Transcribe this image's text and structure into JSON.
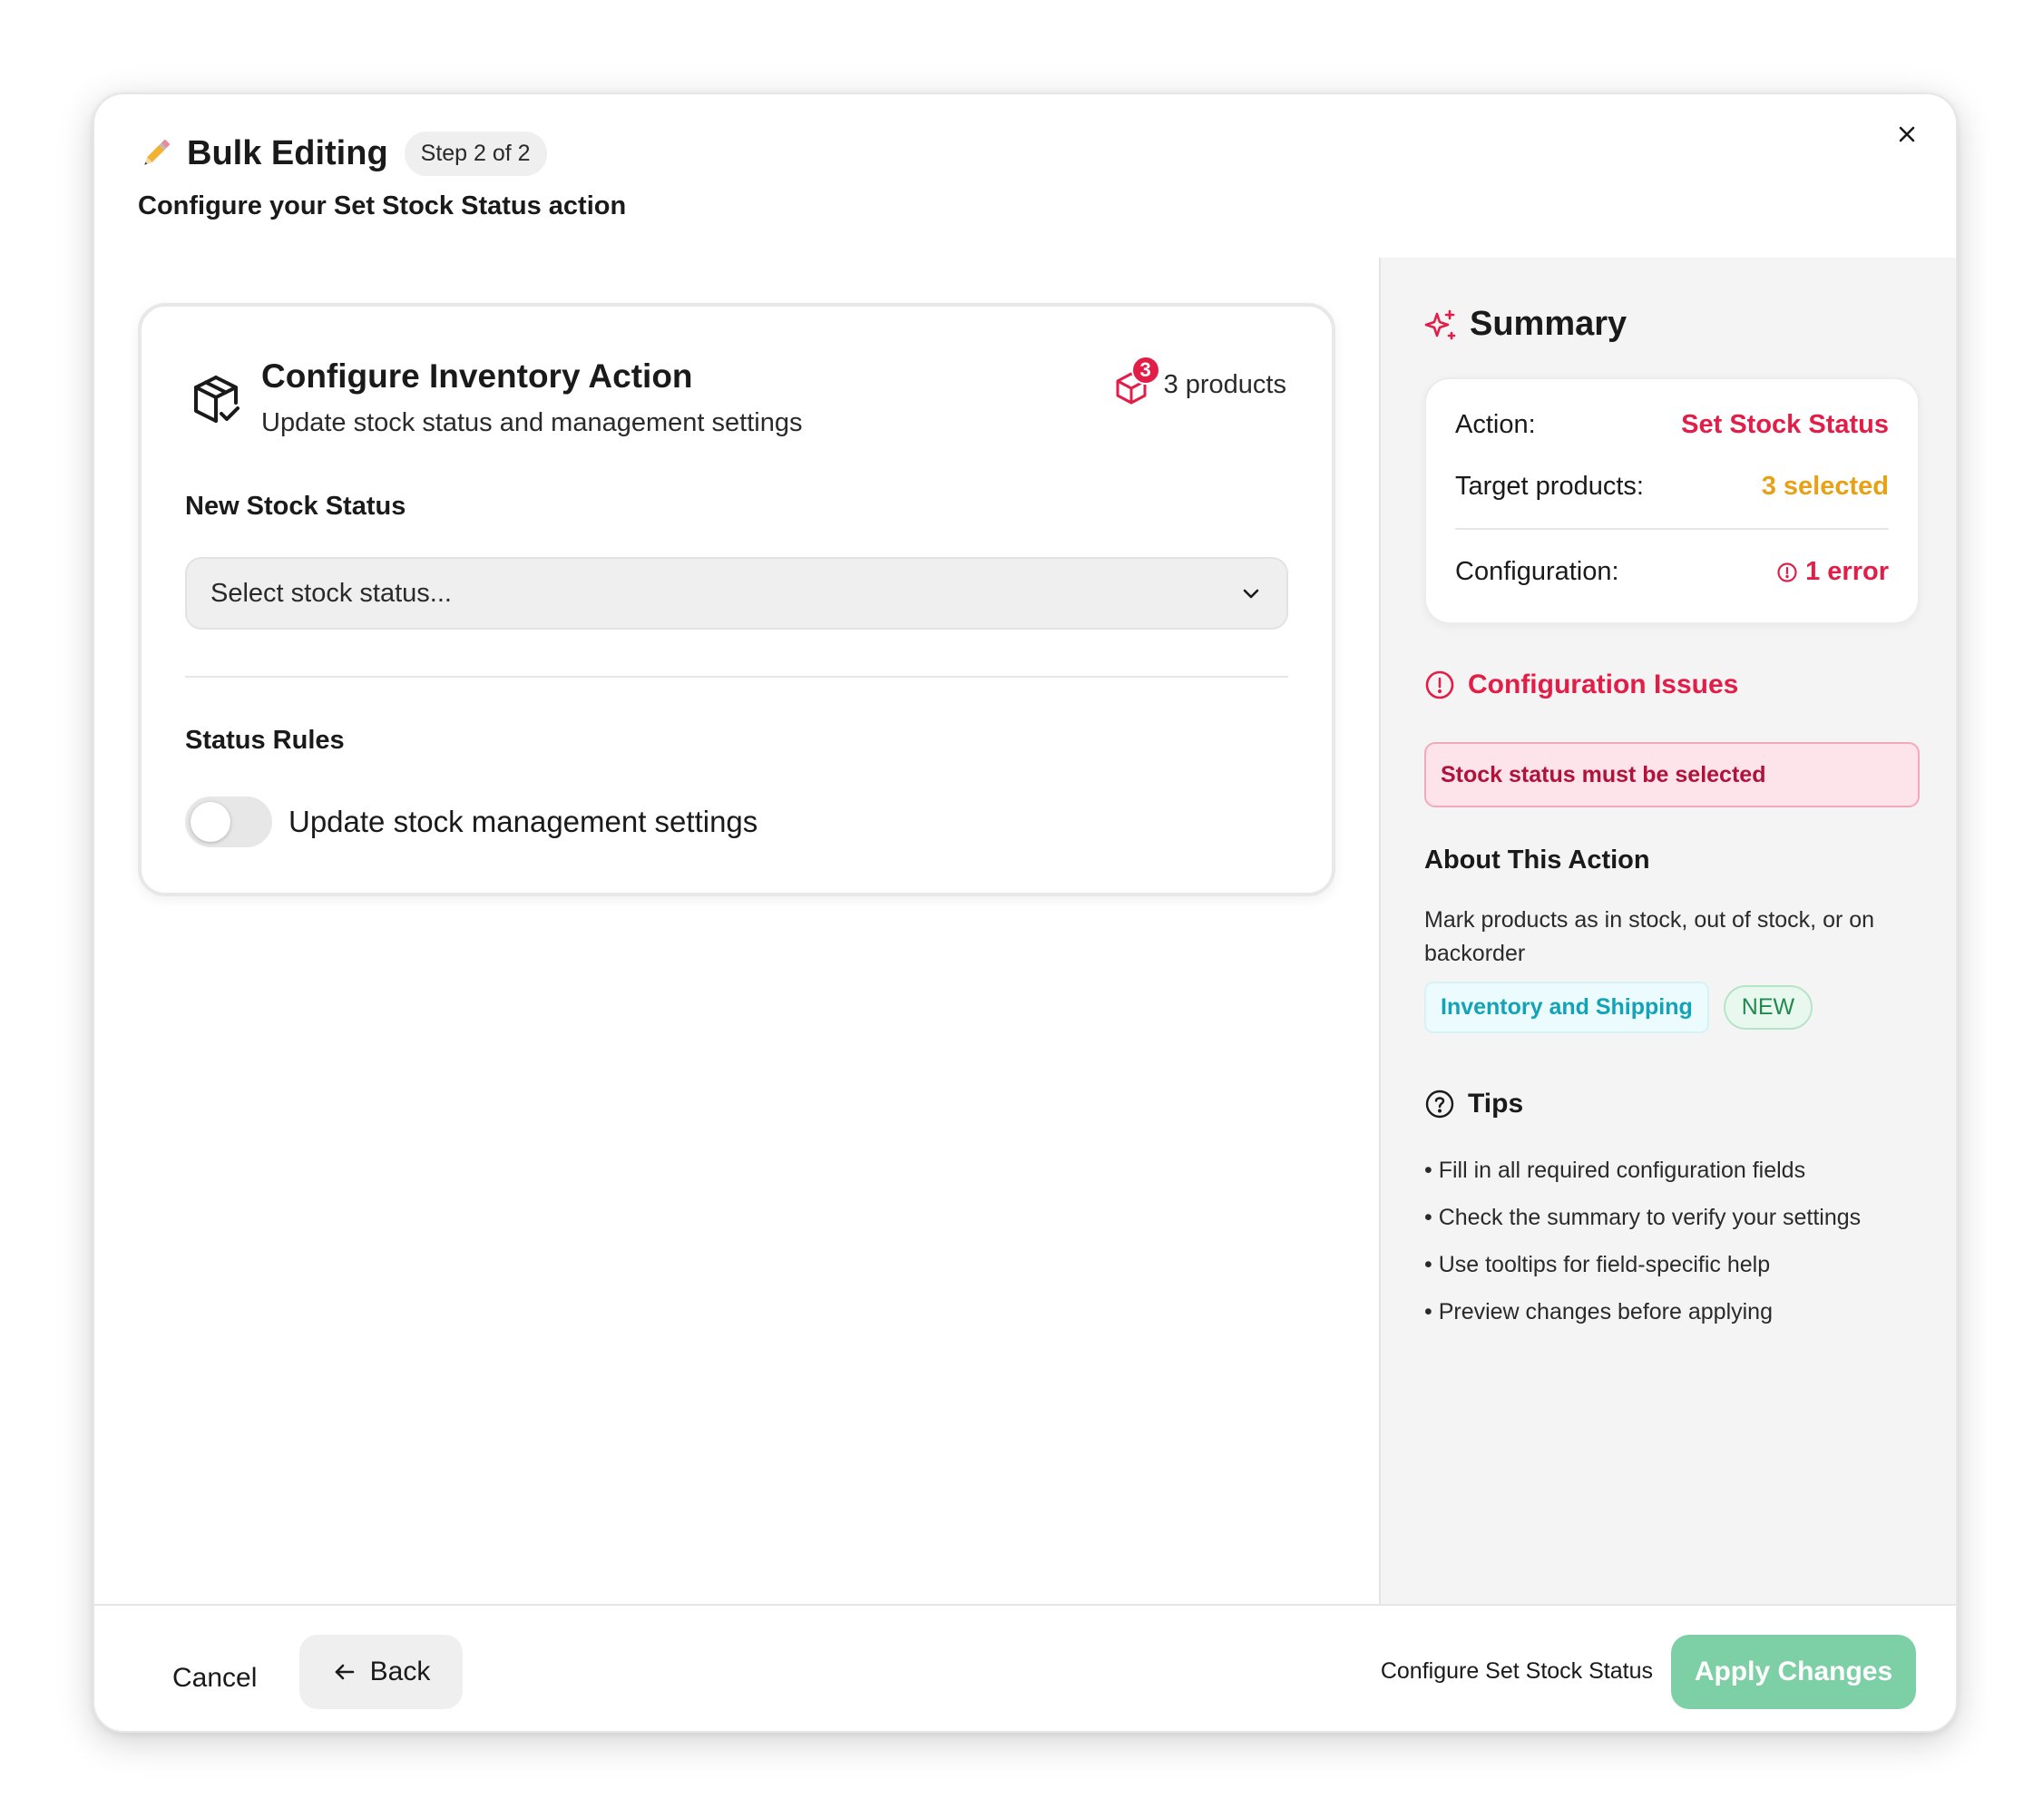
{
  "header": {
    "title": "Bulk Editing",
    "step": "Step 2 of 2",
    "subtitle_prefix": "Configure your ",
    "subtitle_action": "Set Stock Status",
    "subtitle_suffix": " action"
  },
  "card": {
    "title": "Configure Inventory Action",
    "description": "Update stock status and management settings",
    "product_count_badge": "3",
    "products_label": "3 products",
    "field_label": "New Stock Status",
    "select_placeholder": "Select stock status...",
    "rules_label": "Status Rules",
    "toggle_label": "Update stock management settings",
    "toggle_on": false
  },
  "summary": {
    "title": "Summary",
    "action_key": "Action:",
    "action_value": "Set Stock Status",
    "target_key": "Target products:",
    "target_value": "3 selected",
    "config_key": "Configuration:",
    "config_value": "1 error"
  },
  "issues": {
    "title": "Configuration Issues",
    "message": "Stock status must be selected"
  },
  "about": {
    "title": "About This Action",
    "description": "Mark products as in stock, out of stock, or on backorder",
    "category_tag": "Inventory and Shipping",
    "new_tag": "NEW"
  },
  "tips": {
    "title": "Tips",
    "items": [
      "• Fill in all required configuration fields",
      "• Check the summary to verify your settings",
      "• Use tooltips for field-specific help",
      "• Preview changes before applying"
    ]
  },
  "footer": {
    "cancel": "Cancel",
    "back": "Back",
    "hint": "Configure Set Stock Status",
    "apply": "Apply Changes"
  },
  "colors": {
    "accent_red": "#e11d48",
    "amber": "#e6a117",
    "apply_green": "#7dcfa5",
    "teal_tag": "#12a3b8"
  }
}
